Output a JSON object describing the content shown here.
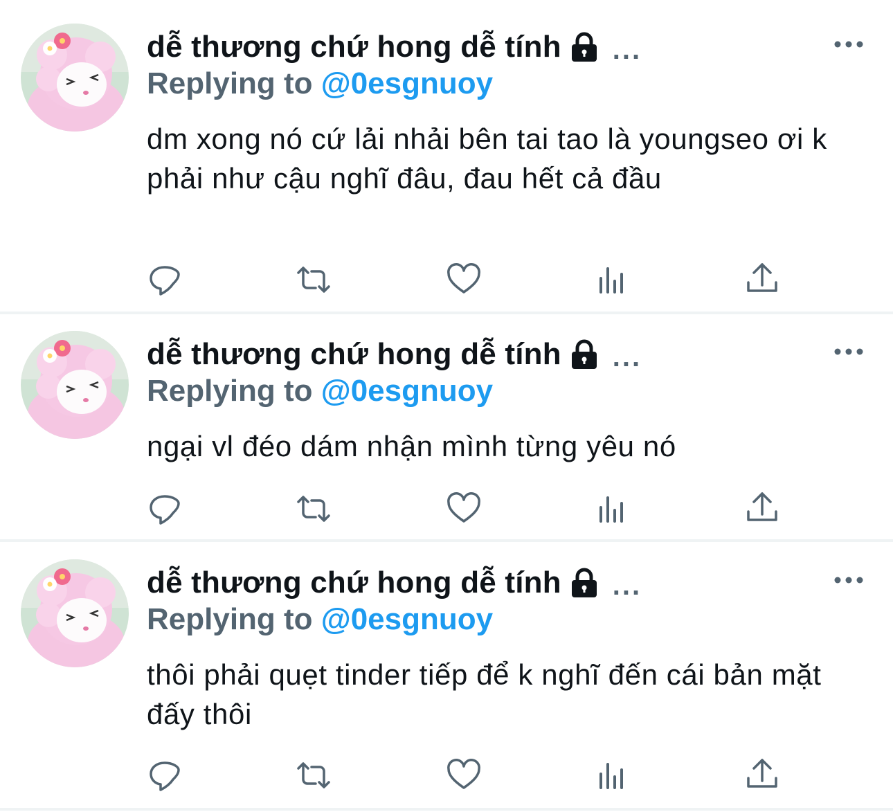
{
  "timeline": {
    "tweets": [
      {
        "author_name": "dễ thương chứ hong dễ tính",
        "handle_truncation": "...",
        "replying_to_label": "Replying to",
        "replying_to_handle": "@0esgnuoy",
        "text": "dm xong nó cứ lải nhải bên tai tao là youngseo ơi k phải như cậu nghĩ đâu, đau hết cả đầu",
        "icons": [
          "lock-icon",
          "more-icon",
          "reply-icon",
          "retweet-icon",
          "like-icon",
          "views-icon",
          "share-icon"
        ]
      },
      {
        "author_name": "dễ thương chứ hong dễ tính",
        "handle_truncation": "...",
        "replying_to_label": "Replying to",
        "replying_to_handle": "@0esgnuoy",
        "text": "ngại vl đéo dám nhận mình từng yêu nó",
        "icons": [
          "lock-icon",
          "more-icon",
          "reply-icon",
          "retweet-icon",
          "like-icon",
          "views-icon",
          "share-icon"
        ]
      },
      {
        "author_name": "dễ thương chứ hong dễ tính",
        "handle_truncation": "...",
        "replying_to_label": "Replying to",
        "replying_to_handle": "@0esgnuoy",
        "text": "thôi phải quẹt tinder tiếp để k nghĩ đến cái bản mặt đấy thôi",
        "icons": [
          "lock-icon",
          "more-icon",
          "reply-icon",
          "retweet-icon",
          "like-icon",
          "views-icon",
          "share-icon"
        ]
      }
    ]
  },
  "colors": {
    "text_primary": "#0f1419",
    "text_secondary": "#536471",
    "link": "#1d9bf0",
    "divider": "#eff3f4",
    "avatar_pink": "#f3b9dc"
  }
}
